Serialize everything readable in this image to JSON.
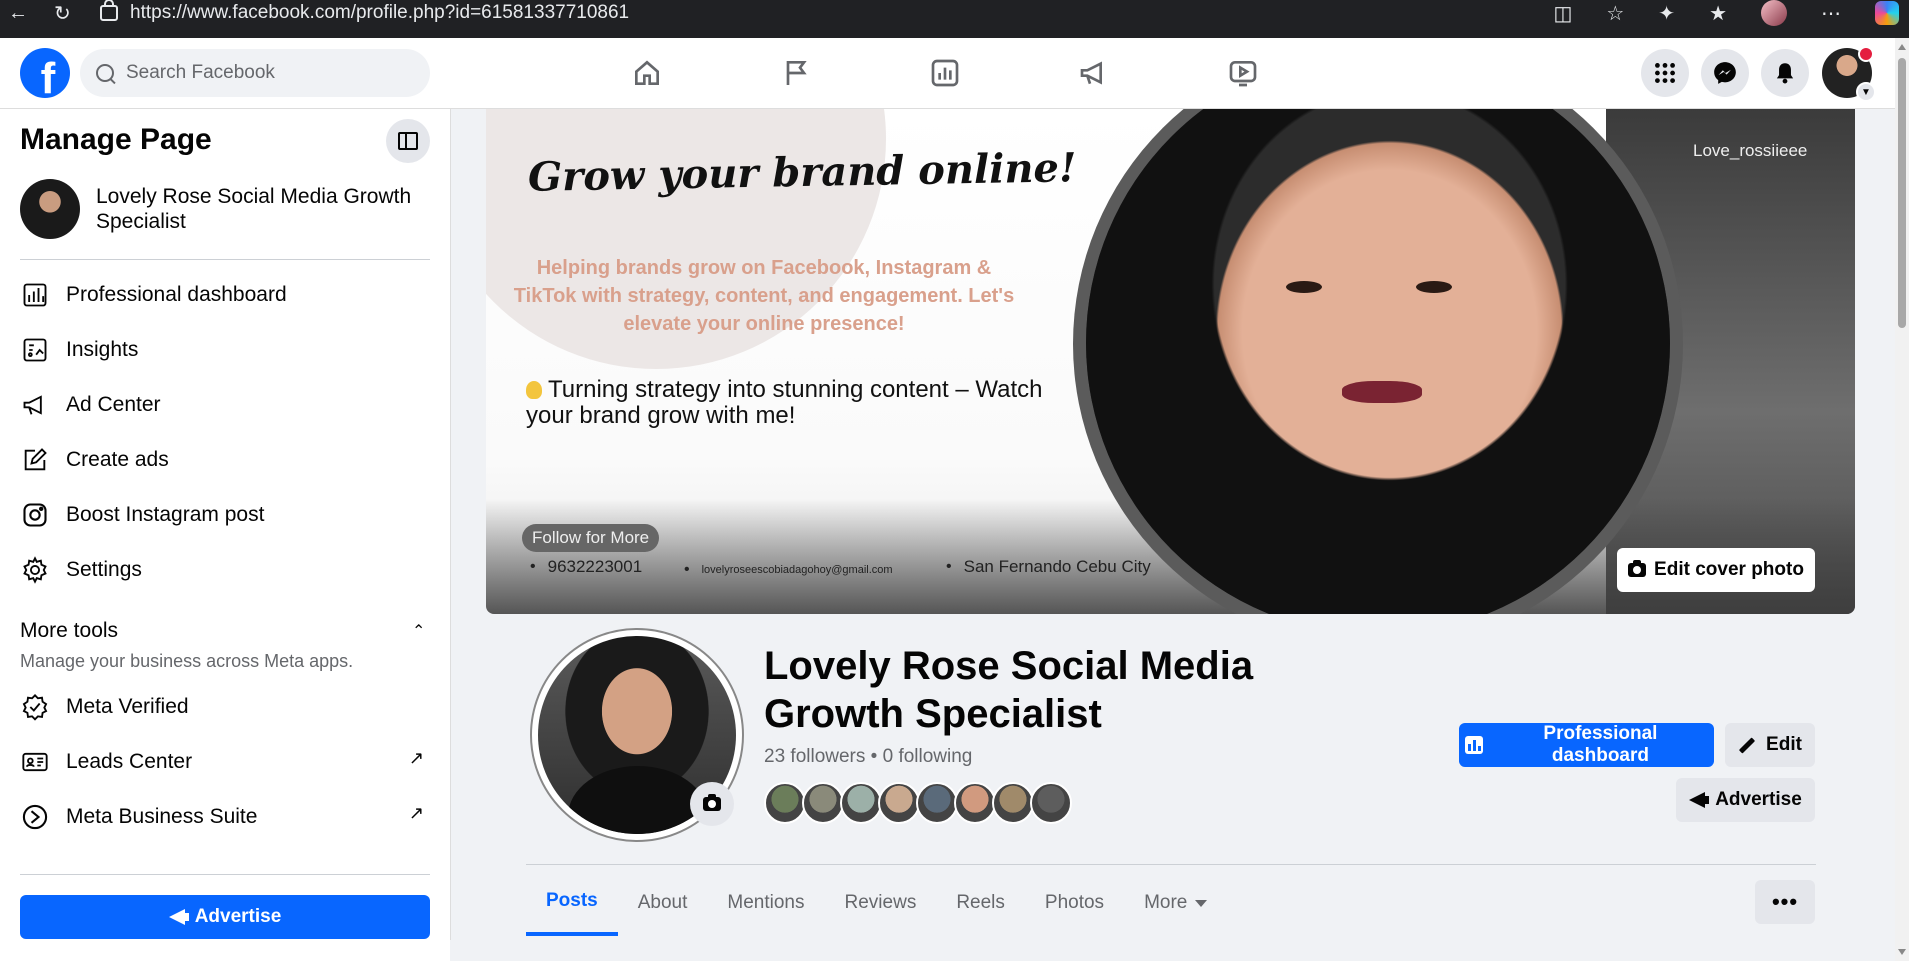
{
  "browser": {
    "url": "https://www.facebook.com/profile.php?id=61581337710861"
  },
  "topbar": {
    "search_placeholder": "Search Facebook",
    "nav_icons": [
      "home-icon",
      "flag-icon",
      "insights-icon",
      "megaphone-icon",
      "video-icon"
    ],
    "right_icons": [
      "menu-grid-icon",
      "messenger-icon",
      "notifications-icon"
    ]
  },
  "sidebar": {
    "title": "Manage Page",
    "page_name": "Lovely Rose Social Media Growth Specialist",
    "items": [
      {
        "label": "Professional dashboard",
        "icon": "dashboard-icon"
      },
      {
        "label": "Insights",
        "icon": "insights-icon"
      },
      {
        "label": "Ad Center",
        "icon": "megaphone-icon"
      },
      {
        "label": "Create ads",
        "icon": "pencil-icon"
      },
      {
        "label": "Boost Instagram post",
        "icon": "instagram-icon"
      },
      {
        "label": "Settings",
        "icon": "gear-icon"
      }
    ],
    "more_tools": {
      "title": "More tools",
      "subtitle": "Manage your business across Meta apps.",
      "items": [
        {
          "label": "Meta Verified",
          "icon": "verified-icon"
        },
        {
          "label": "Leads Center",
          "icon": "leads-icon"
        },
        {
          "label": "Meta Business Suite",
          "icon": "business-suite-icon"
        }
      ]
    },
    "advertise_label": "Advertise"
  },
  "cover": {
    "headline": "Grow your brand online!",
    "subtext": "Helping brands grow on Facebook, Instagram & TikTok with strategy, content, and engagement. Let's elevate your online presence!",
    "tagline": "Turning strategy into stunning content – Watch your brand grow with me!",
    "handle": "Love_rossiieee",
    "follow_label": "Follow for More",
    "phone": "9632223001",
    "email": "lovelyroseescobiadagohoy@gmail.com",
    "location": "San Fernando Cebu City",
    "edit_cover_label": "Edit cover photo"
  },
  "profile": {
    "name": "Lovely Rose Social Media Growth Specialist",
    "followers_text": "23 followers • 0 following",
    "friend_colors": [
      "#6b7d5a",
      "#8a8a7a",
      "#9cb0a8",
      "#c9a98f",
      "#5a6a7a",
      "#d19a7f",
      "#a08a6a",
      "#5d5d5d"
    ],
    "buttons": {
      "professional_dashboard": "Professional dashboard",
      "edit": "Edit",
      "advertise": "Advertise"
    }
  },
  "tabs": [
    {
      "label": "Posts",
      "active": true
    },
    {
      "label": "About",
      "active": false
    },
    {
      "label": "Mentions",
      "active": false
    },
    {
      "label": "Reviews",
      "active": false
    },
    {
      "label": "Reels",
      "active": false
    },
    {
      "label": "Photos",
      "active": false
    },
    {
      "label": "More",
      "active": false
    }
  ],
  "tab_more_label": "•••",
  "colors": {
    "brand": "#0866ff",
    "bg": "#f0f2f5",
    "text_secondary": "#65676b"
  }
}
